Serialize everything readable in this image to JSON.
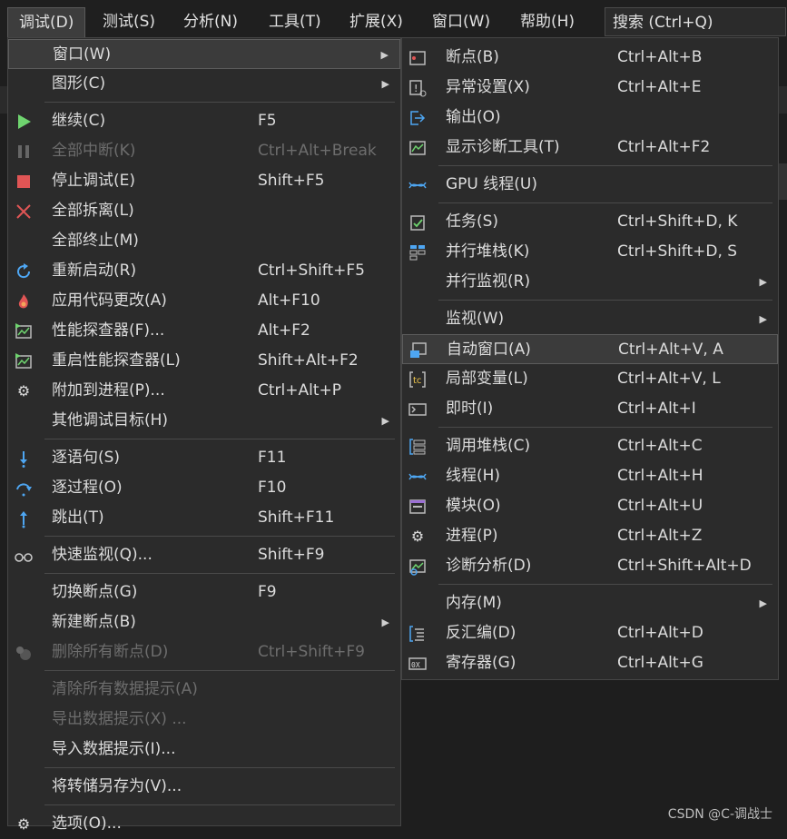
{
  "menubar": {
    "items": [
      {
        "label": "调试(D)",
        "active": true
      },
      {
        "label": "测试(S)"
      },
      {
        "label": "分析(N)"
      },
      {
        "label": "工具(T)"
      },
      {
        "label": "扩展(X)"
      },
      {
        "label": "窗口(W)"
      },
      {
        "label": "帮助(H)"
      }
    ],
    "search": "搜索 (Ctrl+Q)"
  },
  "main_menu": {
    "items": [
      {
        "label": "窗口(W)",
        "shortcut": "",
        "submenu": true,
        "highlight": true,
        "icon": ""
      },
      {
        "label": "图形(C)",
        "shortcut": "",
        "submenu": true,
        "icon": ""
      },
      {
        "label": "继续(C)",
        "shortcut": "F5",
        "icon": "play-icon"
      },
      {
        "label": "全部中断(K)",
        "shortcut": "Ctrl+Alt+Break",
        "disabled": true,
        "icon": "pause-icon"
      },
      {
        "label": "停止调试(E)",
        "shortcut": "Shift+F5",
        "icon": "stop-icon"
      },
      {
        "label": "全部拆离(L)",
        "shortcut": "",
        "icon": "detach-icon"
      },
      {
        "label": "全部终止(M)",
        "shortcut": "",
        "icon": ""
      },
      {
        "label": "重新启动(R)",
        "shortcut": "Ctrl+Shift+F5",
        "icon": "restart-icon"
      },
      {
        "label": "应用代码更改(A)",
        "shortcut": "Alt+F10",
        "icon": "hot-reload-icon"
      },
      {
        "label": "性能探查器(F)...",
        "shortcut": "Alt+F2",
        "icon": "profiler-icon"
      },
      {
        "label": "重启性能探查器(L)",
        "shortcut": "Shift+Alt+F2",
        "icon": "profiler-restart-icon"
      },
      {
        "label": "附加到进程(P)...",
        "shortcut": "Ctrl+Alt+P",
        "icon": "attach-gears-icon"
      },
      {
        "label": "其他调试目标(H)",
        "shortcut": "",
        "submenu": true,
        "icon": ""
      },
      {
        "label": "逐语句(S)",
        "shortcut": "F11",
        "icon": "step-into-icon"
      },
      {
        "label": "逐过程(O)",
        "shortcut": "F10",
        "icon": "step-over-icon"
      },
      {
        "label": "跳出(T)",
        "shortcut": "Shift+F11",
        "icon": "step-out-icon"
      },
      {
        "label": "快速监视(Q)...",
        "shortcut": "Shift+F9",
        "icon": "glasses-icon"
      },
      {
        "label": "切换断点(G)",
        "shortcut": "F9",
        "icon": ""
      },
      {
        "label": "新建断点(B)",
        "shortcut": "",
        "submenu": true,
        "icon": ""
      },
      {
        "label": "删除所有断点(D)",
        "shortcut": "Ctrl+Shift+F9",
        "disabled": true,
        "icon": "delete-breakpoints-icon"
      },
      {
        "label": "清除所有数据提示(A)",
        "shortcut": "",
        "disabled": true,
        "icon": ""
      },
      {
        "label": "导出数据提示(X) ...",
        "shortcut": "",
        "disabled": true,
        "icon": ""
      },
      {
        "label": "导入数据提示(I)...",
        "shortcut": "",
        "icon": ""
      },
      {
        "label": "将转储另存为(V)...",
        "shortcut": "",
        "icon": ""
      },
      {
        "label": "选项(O)...",
        "shortcut": "",
        "icon": "gear-icon"
      }
    ]
  },
  "sub_menu": {
    "items": [
      {
        "label": "断点(B)",
        "shortcut": "Ctrl+Alt+B",
        "icon": "breakpoints-window-icon"
      },
      {
        "label": "异常设置(X)",
        "shortcut": "Ctrl+Alt+E",
        "icon": "exception-settings-icon"
      },
      {
        "label": "输出(O)",
        "shortcut": "",
        "icon": "output-icon"
      },
      {
        "label": "显示诊断工具(T)",
        "shortcut": "Ctrl+Alt+F2",
        "icon": "diagnostic-tools-icon"
      },
      {
        "label": "GPU 线程(U)",
        "shortcut": "",
        "icon": "gpu-threads-icon"
      },
      {
        "label": "任务(S)",
        "shortcut": "Ctrl+Shift+D, K",
        "icon": "tasks-icon"
      },
      {
        "label": "并行堆栈(K)",
        "shortcut": "Ctrl+Shift+D, S",
        "icon": "parallel-stacks-icon"
      },
      {
        "label": "并行监视(R)",
        "shortcut": "",
        "submenu": true,
        "icon": ""
      },
      {
        "label": "监视(W)",
        "shortcut": "",
        "submenu": true,
        "icon": ""
      },
      {
        "label": "自动窗口(A)",
        "shortcut": "Ctrl+Alt+V, A",
        "highlight": true,
        "icon": "autos-icon"
      },
      {
        "label": "局部变量(L)",
        "shortcut": "Ctrl+Alt+V, L",
        "icon": "locals-icon"
      },
      {
        "label": "即时(I)",
        "shortcut": "Ctrl+Alt+I",
        "icon": "immediate-icon"
      },
      {
        "label": "调用堆栈(C)",
        "shortcut": "Ctrl+Alt+C",
        "icon": "call-stack-icon"
      },
      {
        "label": "线程(H)",
        "shortcut": "Ctrl+Alt+H",
        "icon": "threads-icon"
      },
      {
        "label": "模块(O)",
        "shortcut": "Ctrl+Alt+U",
        "icon": "modules-icon"
      },
      {
        "label": "进程(P)",
        "shortcut": "Ctrl+Alt+Z",
        "icon": "processes-icon"
      },
      {
        "label": "诊断分析(D)",
        "shortcut": "Ctrl+Shift+Alt+D",
        "icon": "diagnostic-analysis-icon"
      },
      {
        "label": "内存(M)",
        "shortcut": "",
        "submenu": true,
        "icon": ""
      },
      {
        "label": "反汇编(D)",
        "shortcut": "Ctrl+Alt+D",
        "icon": "disassembly-icon"
      },
      {
        "label": "寄存器(G)",
        "shortcut": "Ctrl+Alt+G",
        "icon": "registers-icon"
      }
    ]
  },
  "watermark": "CSDN @C-调战士",
  "colors": {
    "menu_bg": "#2b2b2b",
    "accent_green": "#6fd46f",
    "accent_red": "#e05555",
    "accent_blue": "#4ea6f2"
  }
}
